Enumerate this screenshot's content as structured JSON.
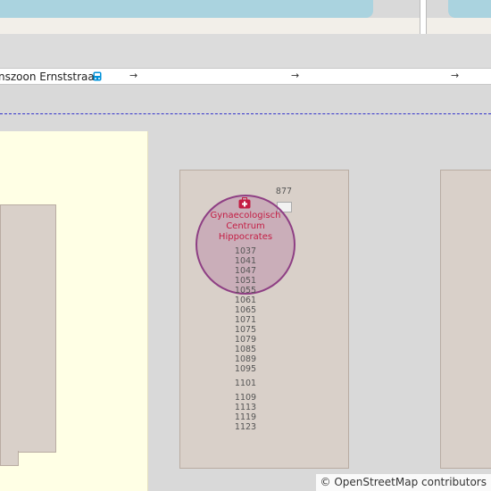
{
  "map": {
    "street_name": "nszoon Ernststraat",
    "bus_stop_icon": "bus-stop-icon",
    "one_way_arrow": "→",
    "poi": {
      "name_lines": [
        "Gynaecologisch",
        "Centrum",
        "Hippocrates"
      ],
      "icon": "medical-cross-icon",
      "circle_color": "#b06f9a"
    },
    "house_numbers_top": [
      "877"
    ],
    "house_numbers_column": [
      "1037",
      "1041",
      "1047",
      "1051",
      "1055",
      "1061",
      "1065",
      "1071",
      "1075",
      "1079",
      "1085",
      "1089",
      "1095"
    ],
    "house_numbers_lower_a": [
      "1101"
    ],
    "house_numbers_lower_b": [
      "1109",
      "1113",
      "1119",
      "1123"
    ],
    "attribution": "© OpenStreetMap contributors",
    "colors": {
      "water": "#aad3df",
      "background": "#d9d9d9",
      "building": "#d9d0c9",
      "residential": "#ffffe5",
      "boundary": "#3333cc"
    }
  }
}
